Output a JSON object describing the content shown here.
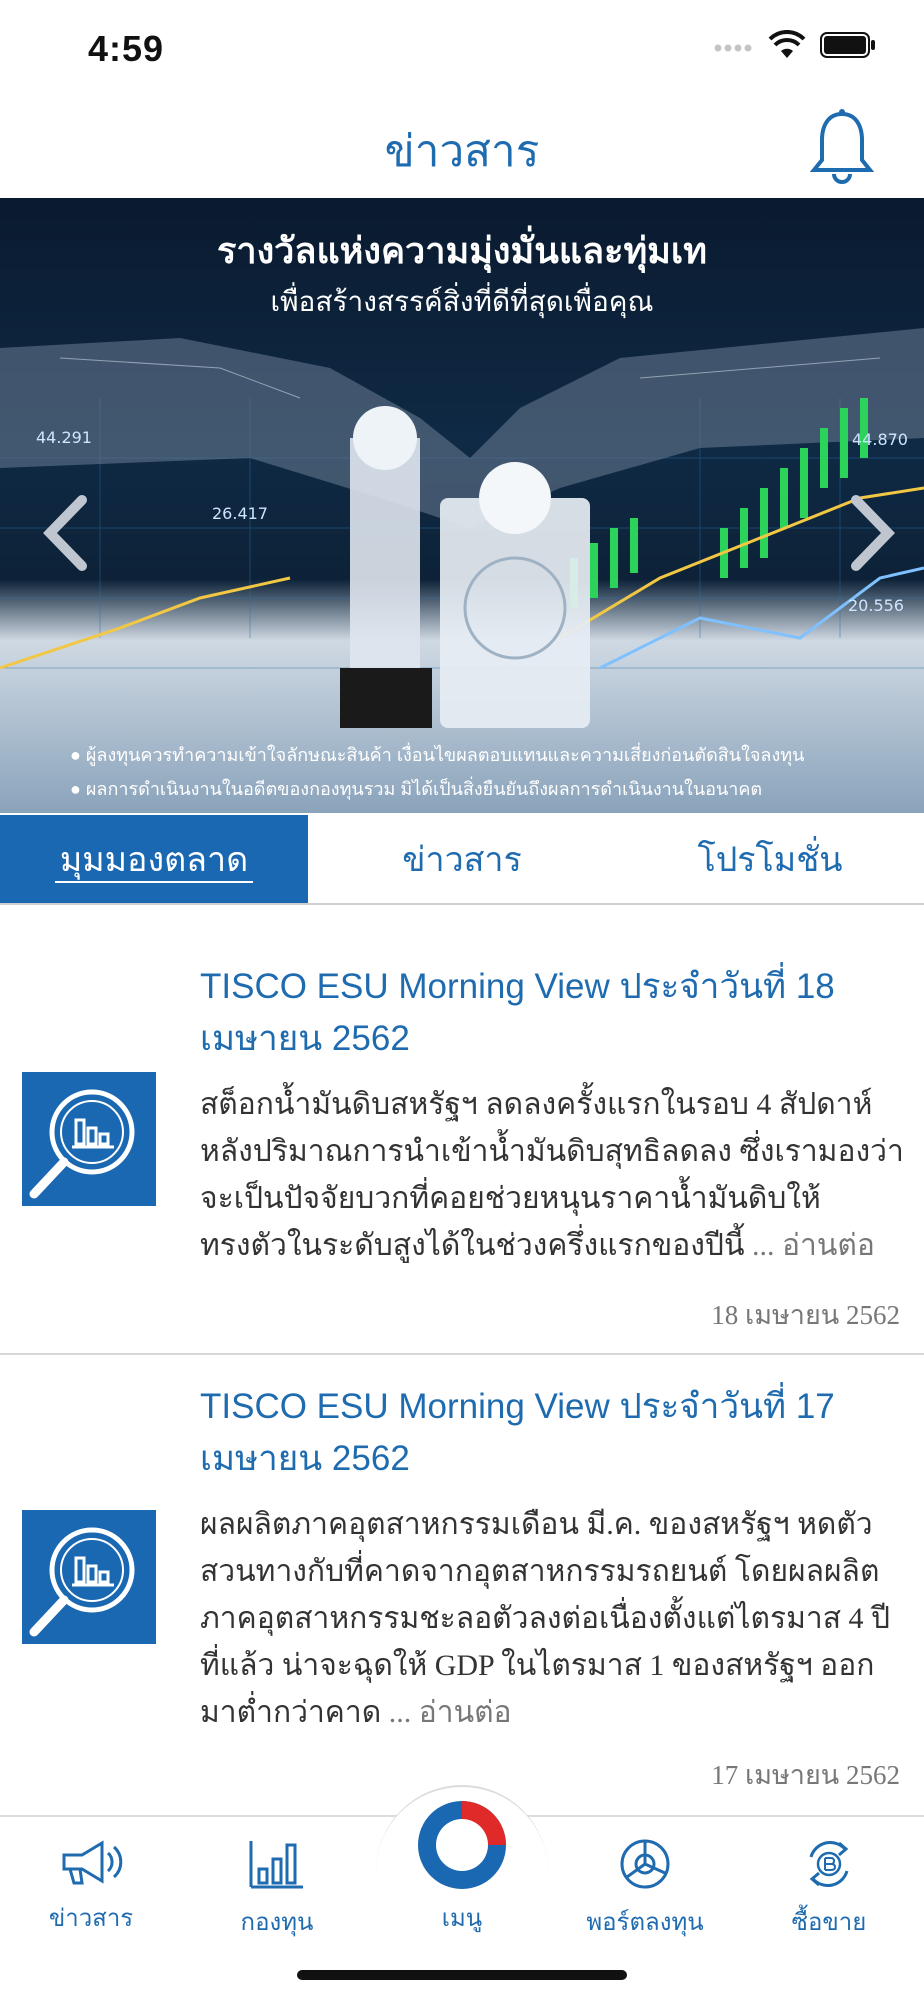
{
  "status_bar": {
    "time": "4:59"
  },
  "header": {
    "title": "ข่าวสาร"
  },
  "banner": {
    "title_line1": "รางวัลแห่งความมุ่งมั่นและทุ่มเท",
    "title_line2": "เพื่อสร้างสรรค์สิ่งที่ดีที่สุดเพื่อคุณ",
    "disclaimer1": "● ผู้ลงทุนควรทำความเข้าใจลักษณะสินค้า เงื่อนไขผลตอบแทนและความเสี่ยงก่อนตัดสินใจลงทุน",
    "disclaimer2": "● ผลการดำเนินงานในอดีตของกองทุนรวม มิได้เป็นสิ่งยืนยันถึงผลการดำเนินงานในอนาคต",
    "numbers": [
      "44.291",
      "26.417",
      "44.870",
      "20.556"
    ]
  },
  "tabs": [
    {
      "label": "มุมมองตลาด",
      "active": true
    },
    {
      "label": "ข่าวสาร",
      "active": false
    },
    {
      "label": "โปรโมชั่น",
      "active": false
    }
  ],
  "news": [
    {
      "title": "TISCO ESU Morning View ประจำวันที่ 18 เมษายน 2562",
      "body": "สต็อกน้ำมันดิบสหรัฐฯ ลดลงครั้งแรกในรอบ 4 สัปดาห์ หลังปริมาณการนำเข้าน้ำมันดิบสุทธิลดลง ซึ่งเรามองว่าจะเป็นปัจจัยบวกที่คอยช่วยหนุนราคาน้ำมันดิบให้ทรงตัวในระดับสูงได้ในช่วงครึ่งแรกของปีนี้",
      "read_more": "... อ่านต่อ",
      "date": "18 เมษายน 2562"
    },
    {
      "title": "TISCO ESU Morning View ประจำวันที่ 17 เมษายน 2562",
      "body": "ผลผลิตภาคอุตสาหกรรมเดือน มี.ค. ของสหรัฐฯ หดตัวสวนทางกับที่คาดจากอุตสาหกรรมรถยนต์ โดยผลผลิตภาคอุตสาหกรรมชะลอตัวลงต่อเนื่องตั้งแต่ไตรมาส 4 ปีที่แล้ว น่าจะฉุดให้ GDP ในไตรมาส 1 ของสหรัฐฯ ออกมาต่ำกว่าคาด",
      "read_more": "... อ่านต่อ",
      "date": "17 เมษายน 2562"
    }
  ],
  "bottom_nav": [
    {
      "label": "ข่าวสาร",
      "icon": "megaphone-icon"
    },
    {
      "label": "กองทุน",
      "icon": "bar-chart-icon"
    },
    {
      "label": "เมนู",
      "icon": "menu-logo-icon"
    },
    {
      "label": "พอร์ตลงทุน",
      "icon": "pie-chart-icon"
    },
    {
      "label": "ซื้อขาย",
      "icon": "exchange-icon"
    }
  ],
  "colors": {
    "accent": "#1f6bb0",
    "tab_active": "#1a67b2"
  }
}
